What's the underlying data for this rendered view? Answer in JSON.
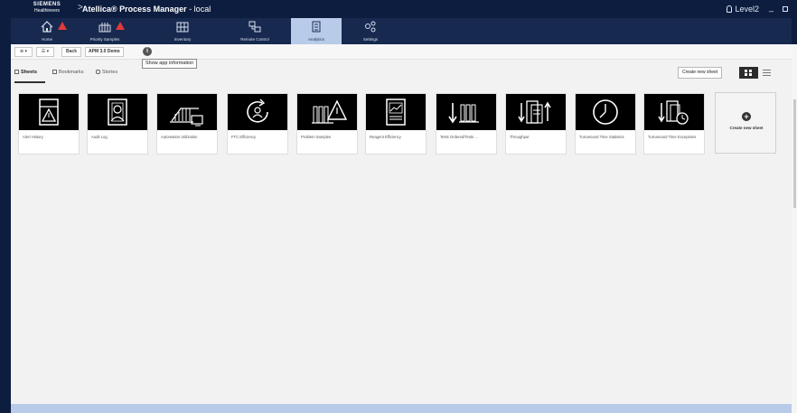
{
  "titlebar": {
    "brand_line1": "SIEMENS",
    "brand_line2": "Healthineers",
    "app_name": "Atellica® Process Manager",
    "app_suffix": " - local",
    "user": "Level2",
    "min_symbol": "_"
  },
  "nav": {
    "items": [
      {
        "label": "Home",
        "icon": "home-icon",
        "warning": true
      },
      {
        "label": "Priority Samples",
        "icon": "priority-samples-icon",
        "warning": true
      },
      {
        "label": "Inventory",
        "icon": "inventory-icon",
        "warning": false
      },
      {
        "label": "Remote Control",
        "icon": "remote-control-icon",
        "warning": false
      },
      {
        "label": "Analytics",
        "icon": "analytics-icon",
        "warning": false,
        "active": true
      },
      {
        "label": "Settings",
        "icon": "settings-icon",
        "warning": false
      }
    ]
  },
  "toolbar": {
    "btn1": "⊕ ▾",
    "btn2": "☰ ▾",
    "back_label": "Back",
    "sheet_name": "APM 3.0 Demo",
    "info_symbol": "i",
    "tooltip": "Show app information"
  },
  "tabs": [
    {
      "label": "Sheets",
      "active": true
    },
    {
      "label": "Bookmarks",
      "active": false
    },
    {
      "label": "Stories",
      "active": false
    }
  ],
  "create_sheet_label": "Create new sheet",
  "cards": [
    {
      "label": "Alert History",
      "icon": "alert-history-icon"
    },
    {
      "label": "Audit Log",
      "icon": "audit-log-icon"
    },
    {
      "label": "Automation Utilization",
      "icon": "automation-utilization-icon"
    },
    {
      "label": "FTC Efficiency",
      "icon": "ftc-efficiency-icon"
    },
    {
      "label": "Problem Samples",
      "icon": "problem-samples-icon"
    },
    {
      "label": "Reagent Efficiency",
      "icon": "reagent-efficiency-icon"
    },
    {
      "label": "Tests Ordered/Tests ...",
      "icon": "tests-ordered-icon"
    },
    {
      "label": "Throughput",
      "icon": "throughput-icon"
    },
    {
      "label": "Turnaround Time Statistics",
      "icon": "tat-statistics-icon"
    },
    {
      "label": "Turnaround Time Exceptions",
      "icon": "tat-exceptions-icon"
    }
  ],
  "create_card": {
    "plus": "+",
    "label": "Create new sheet"
  },
  "colors": {
    "titlebar": "#0d1d3f",
    "navbar": "#17294f",
    "nav_active": "#b8cbe8",
    "warning": "#e03a3a",
    "content_bg": "#f2f2f2"
  }
}
